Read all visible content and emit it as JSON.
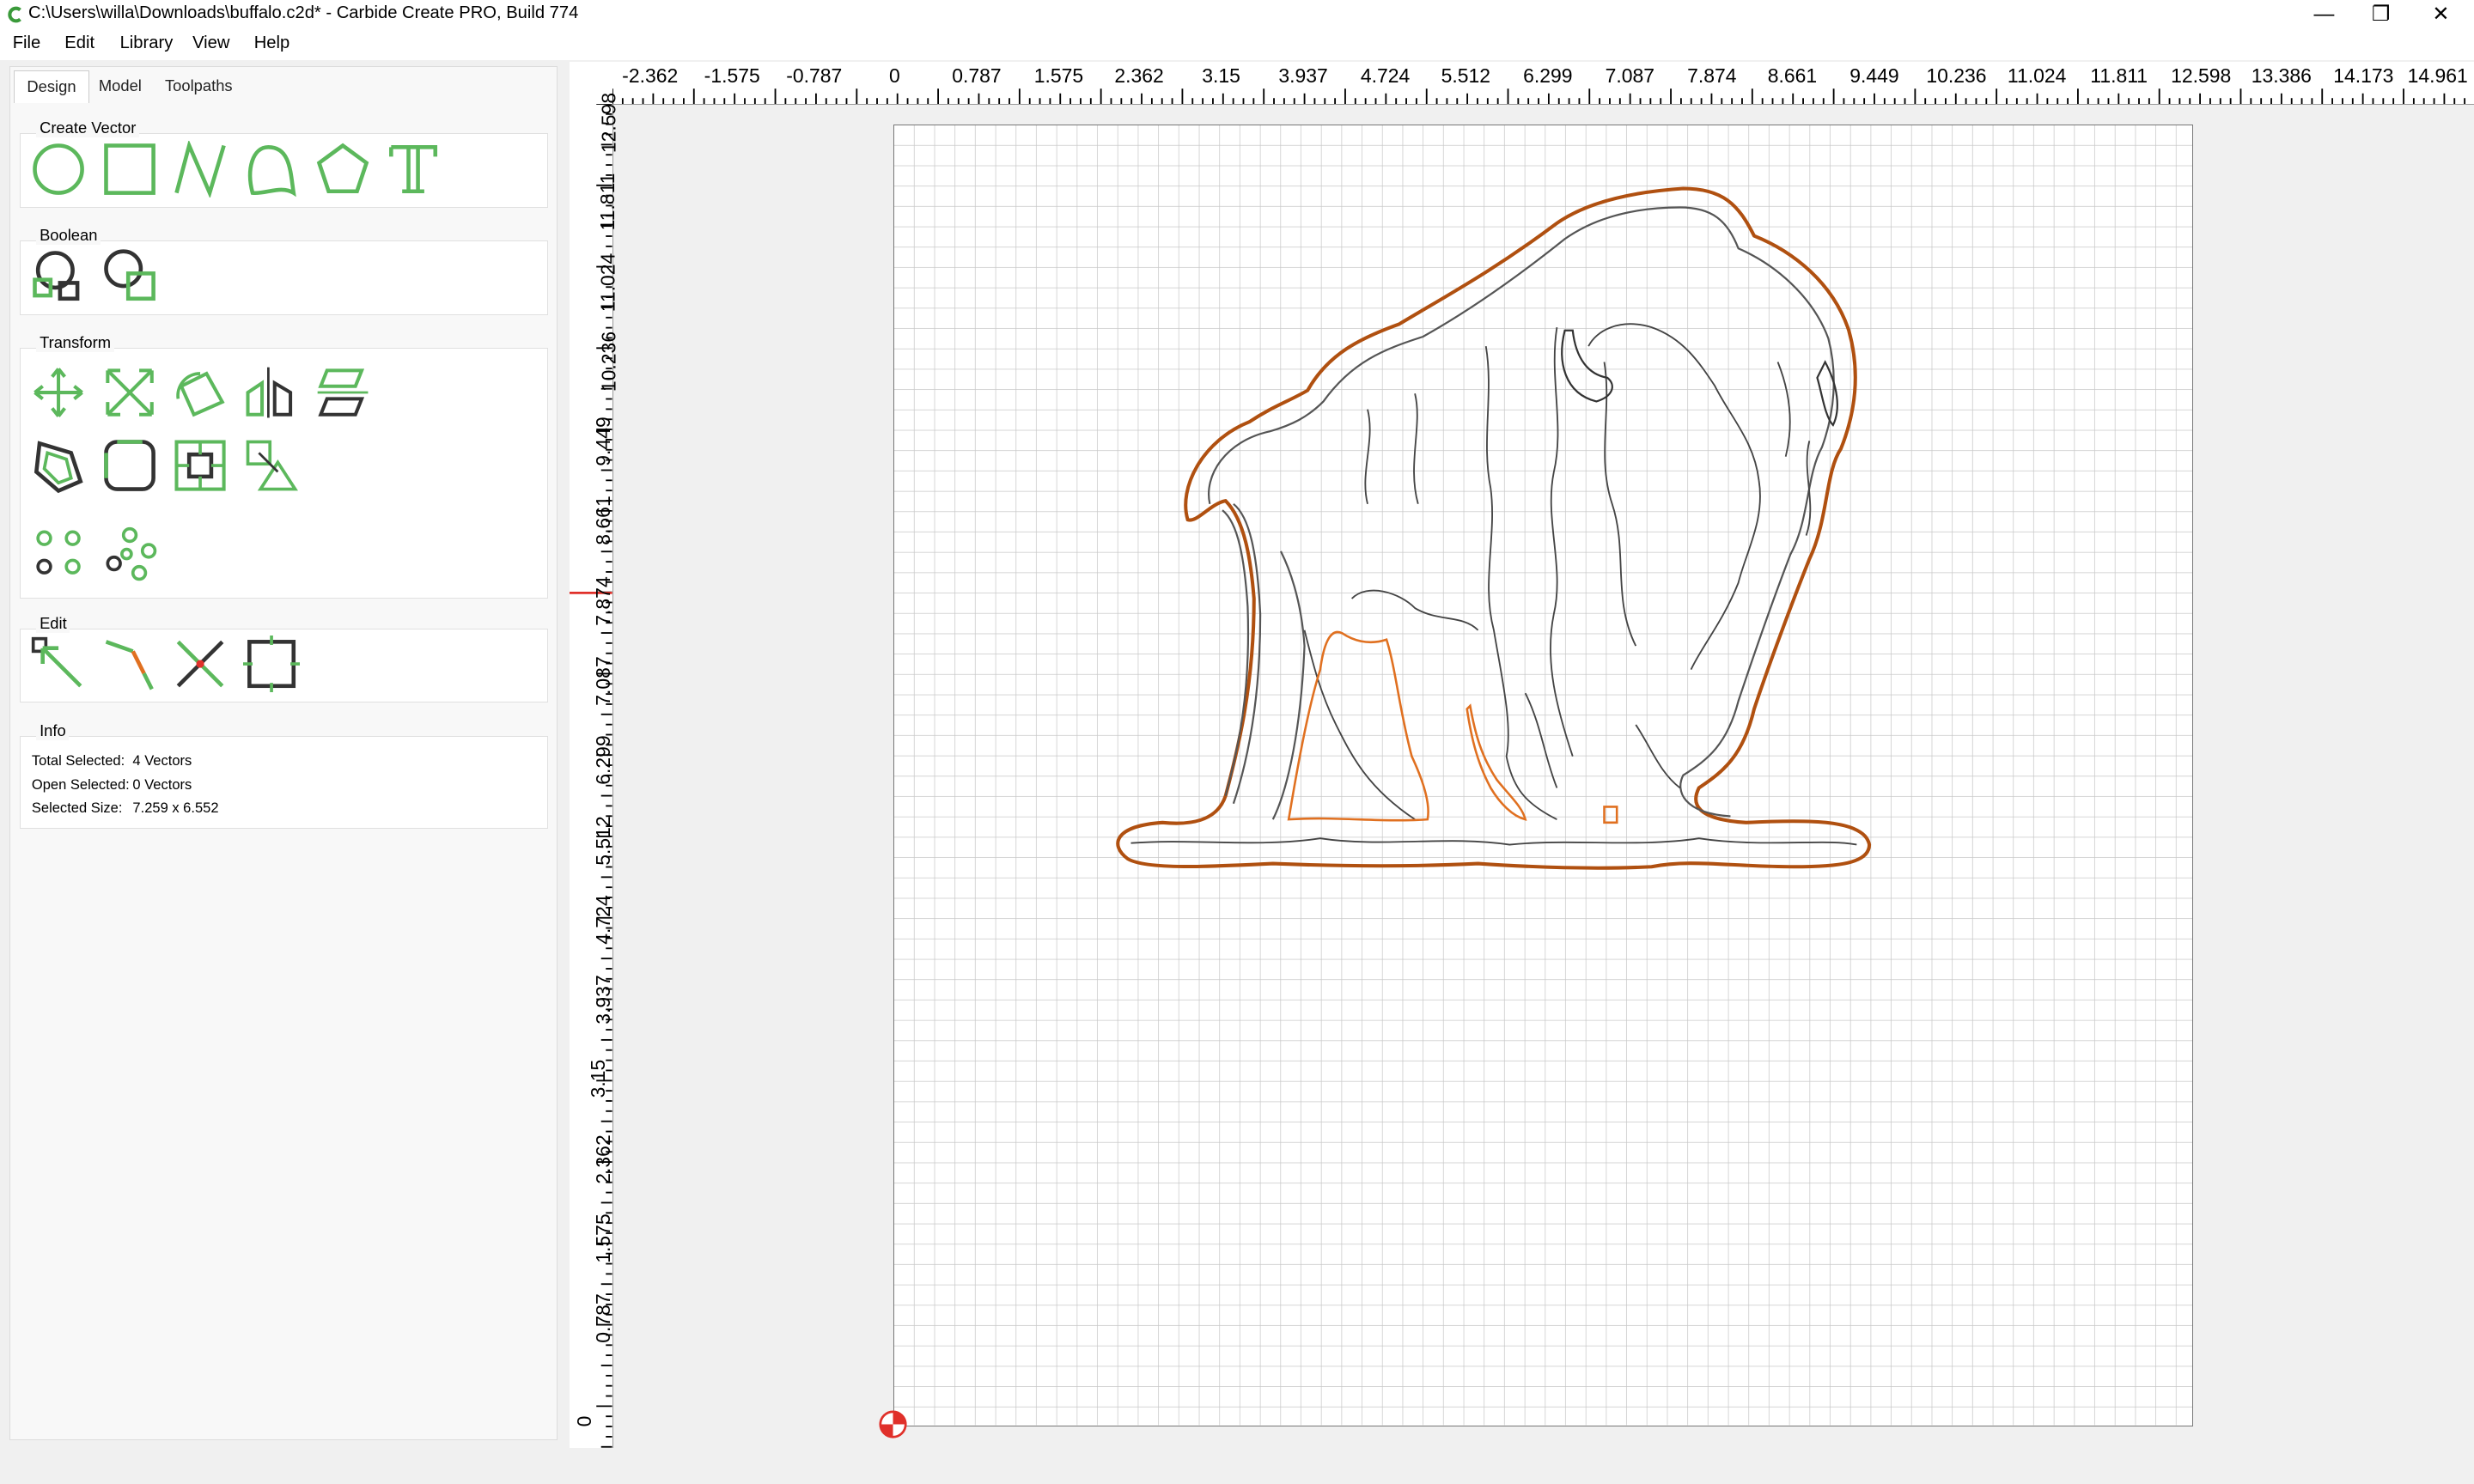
{
  "window": {
    "title": "C:\\Users\\willa\\Downloads\\buffalo.c2d* - Carbide Create PRO, Build 774",
    "minimize": "—",
    "restore": "❐",
    "close": "✕"
  },
  "menu": [
    "File",
    "Edit",
    "Library",
    "View",
    "Help"
  ],
  "tabs": [
    "Design",
    "Model",
    "Toolpaths"
  ],
  "groups": {
    "create_vector": "Create Vector",
    "boolean": "Boolean",
    "transform": "Transform",
    "edit": "Edit",
    "info": "Info"
  },
  "info": {
    "total_label": "Total Selected:",
    "total_value": "4 Vectors",
    "open_label": "Open Selected:",
    "open_value": "0 Vectors",
    "size_label": "Selected Size:",
    "size_value": "7.259 x 6.552"
  },
  "ruler_h": [
    "-2.362",
    "-1.575",
    "-0.787",
    "0",
    "0.787",
    "1.575",
    "2.362",
    "3.15",
    "3.937",
    "4.724",
    "5.512",
    "6.299",
    "7.087",
    "7.874",
    "8.661",
    "9.449",
    "10.236",
    "11.024",
    "11.811",
    "12.598",
    "13.386",
    "14.173",
    "14.961"
  ],
  "ruler_v": [
    "12.598",
    "11.811",
    "11.024",
    "10.236",
    "9.449",
    "8.661",
    "7.874",
    "7.087",
    "6.299",
    "5.512",
    "4.724",
    "3.937",
    "3.15",
    "2.362",
    "1.575",
    "0.787",
    "0"
  ],
  "colors": {
    "tool_green": "#5cb85c",
    "tool_dark": "#333333",
    "selection_orange": "#e07020",
    "outline_brown": "#b05010"
  }
}
